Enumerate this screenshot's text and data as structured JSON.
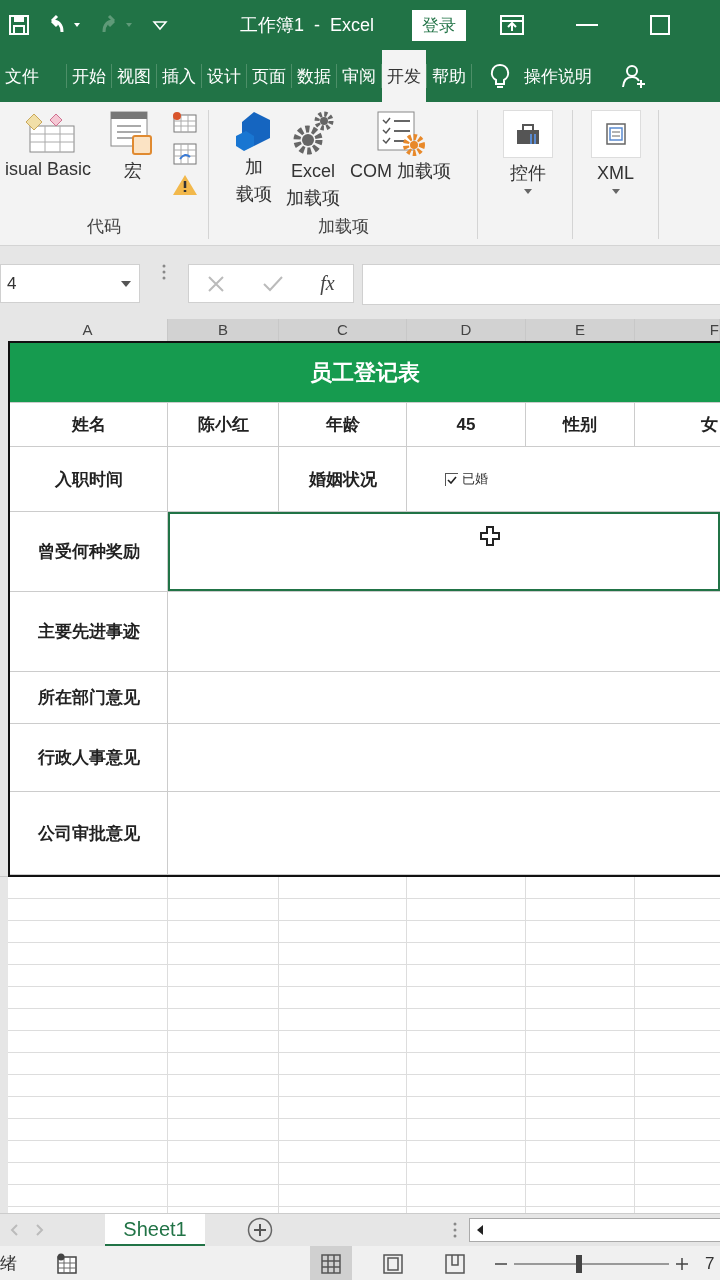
{
  "title_bar": {
    "title": "工作簿1  -  Excel",
    "login_button": "登录"
  },
  "ribbon_tabs": [
    {
      "label": "文件",
      "selected": false
    },
    {
      "label": "开始",
      "selected": false
    },
    {
      "label": "视图",
      "selected": false
    },
    {
      "label": "插入",
      "selected": false
    },
    {
      "label": "设计",
      "selected": false
    },
    {
      "label": "页面",
      "selected": false
    },
    {
      "label": "数据",
      "selected": false
    },
    {
      "label": "审阅",
      "selected": false
    },
    {
      "label": "开发",
      "selected": true
    },
    {
      "label": "帮助",
      "selected": false
    }
  ],
  "tell_me": "操作说明",
  "ribbon_groups": [
    {
      "label": "代码",
      "buttons": [
        {
          "lines": [
            "isual Basic"
          ]
        },
        {
          "lines": [
            "宏"
          ]
        }
      ]
    },
    {
      "label": "加载项",
      "buttons": [
        {
          "lines": [
            "加",
            "载项"
          ]
        },
        {
          "lines": [
            "Excel",
            "加载项"
          ]
        },
        {
          "lines": [
            "COM 加载项"
          ]
        }
      ]
    },
    {
      "buttons": [
        {
          "lines": [
            "控件"
          ]
        }
      ]
    },
    {
      "buttons": [
        {
          "lines": [
            "XML"
          ]
        }
      ]
    }
  ],
  "formula_bar": {
    "name_box": "4",
    "fx": "fx"
  },
  "column_headers": [
    {
      "label": "A",
      "selected": false
    },
    {
      "label": "B",
      "selected": true
    },
    {
      "label": "C",
      "selected": true
    },
    {
      "label": "D",
      "selected": true
    },
    {
      "label": "E",
      "selected": true
    },
    {
      "label": "F",
      "selected": true
    }
  ],
  "form": {
    "title": "员工登记表",
    "info_row": [
      "姓名",
      "陈小红",
      "年龄",
      "45",
      "性别",
      "女"
    ],
    "hire_row": {
      "label": "入职时间",
      "marital_label": "婚姻状况",
      "checkbox": {
        "label": "已婚",
        "checked": true
      }
    },
    "remark_rows": [
      {
        "label": "曾受何种奖励",
        "selected": true
      },
      {
        "label": "主要先进事迹",
        "selected": false
      },
      {
        "label": "所在部门意见",
        "selected": false
      },
      {
        "label": "行政人事意见",
        "selected": false
      },
      {
        "label": "公司审批意见",
        "selected": false
      }
    ]
  },
  "sheet_tabs": [
    {
      "label": "Sheet1",
      "selected": true
    }
  ],
  "status_bar": {
    "status": "绪",
    "view_buttons": [
      {
        "selected": true
      },
      {
        "selected": false
      },
      {
        "selected": false
      }
    ],
    "zoom_slider": {
      "level": 0.4
    },
    "zoom": "7"
  }
}
